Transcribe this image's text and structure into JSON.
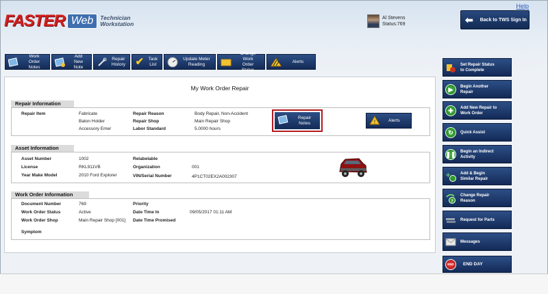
{
  "header": {
    "logo_faster": "FASTER",
    "logo_web": "Web",
    "logo_tw_line1": "Technician",
    "logo_tw_line2": "Workstation",
    "help": "Help",
    "user_name": "Al Stevens",
    "user_status": "Status:769",
    "back_button": "Back to TWS Sign In"
  },
  "toolbar": [
    {
      "line1": "Work Order",
      "line2": "Notes",
      "icon": "notebook-icon"
    },
    {
      "line1": "Add New",
      "line2": "Note",
      "icon": "add-note-icon"
    },
    {
      "line1": "Repair",
      "line2": "History",
      "icon": "wrench-icon"
    },
    {
      "line1": "Task",
      "line2": "List",
      "icon": "checkmark-icon"
    },
    {
      "line1": "Update Meter",
      "line2": "Reading",
      "icon": "meter-icon"
    },
    {
      "line1": "Change Work",
      "line2": "Order Status",
      "icon": "folder-icon"
    },
    {
      "line1": "Alerts",
      "line2": "",
      "icon": "hazard-icon"
    }
  ],
  "main": {
    "title": "My Work Order Repair",
    "repair": {
      "heading": "Repair Information",
      "item_label": "Repair Item",
      "items": [
        "Fabricate",
        "Baton Holder",
        "Accessory Emer"
      ],
      "reason_label": "Repair Reason",
      "reason": "Body Repair, Non-Accident",
      "shop_label": "Repair Shop",
      "shop": "Main Repair Shop",
      "labor_label": "Labor Standard",
      "labor": "5.0000 hours",
      "notes_button_line1": "Repair",
      "notes_button_line2": "Notes",
      "alerts_button": "Alerts"
    },
    "asset": {
      "heading": "Asset Information",
      "number_label": "Asset Number",
      "number": "1002",
      "relabelable_label": "Relabelable",
      "license_label": "License",
      "license": "RKL911VB",
      "org_label": "Organization",
      "org": "001",
      "ymm_label": "Year Make Model",
      "ymm": "2010 Ford Explorer",
      "vin_label": "VIN/Serial Number",
      "vin": "4P1CT02EX2A002307"
    },
    "workorder": {
      "heading": "Work Order Information",
      "doc_label": "Document Number",
      "doc": "769",
      "priority_label": "Priority",
      "status_label": "Work Order Status",
      "status": "Active",
      "datein_label": "Date Time In",
      "datein": "09/05/2017 01:11 AM",
      "shop_label": "Work Order Shop",
      "shop": "Main Repair Shop [001]",
      "promised_label": "Date Time Promised",
      "symptom_label": "Symptom"
    }
  },
  "right_panel": [
    {
      "line1": "Set Repair Status",
      "line2": "to Complete",
      "icon": "complete-status-icon"
    },
    {
      "line1": "Begin Another",
      "line2": "Repair",
      "icon": "play-icon"
    },
    {
      "line1": "Add New Repair to",
      "line2": "Work Order",
      "icon": "plus-icon"
    },
    {
      "line1": "Quick Assist",
      "line2": "",
      "icon": "refresh-icon"
    },
    {
      "line1": "Begin an Indirect",
      "line2": "Activity",
      "icon": "pause-icon"
    },
    {
      "line1": "Add & Begin",
      "line2": "Similar Repair",
      "icon": "add-begin-icon"
    },
    {
      "line1": "Change Repair",
      "line2": "Reason",
      "icon": "change-reason-icon"
    },
    {
      "line1": "Request for Parts",
      "line2": "",
      "icon": "parts-icon"
    },
    {
      "line1": "Messages",
      "line2": "",
      "icon": "envelope-icon"
    },
    {
      "line1": "END DAY",
      "line2": "",
      "icon": "end-day-icon",
      "end_text": "END"
    }
  ]
}
